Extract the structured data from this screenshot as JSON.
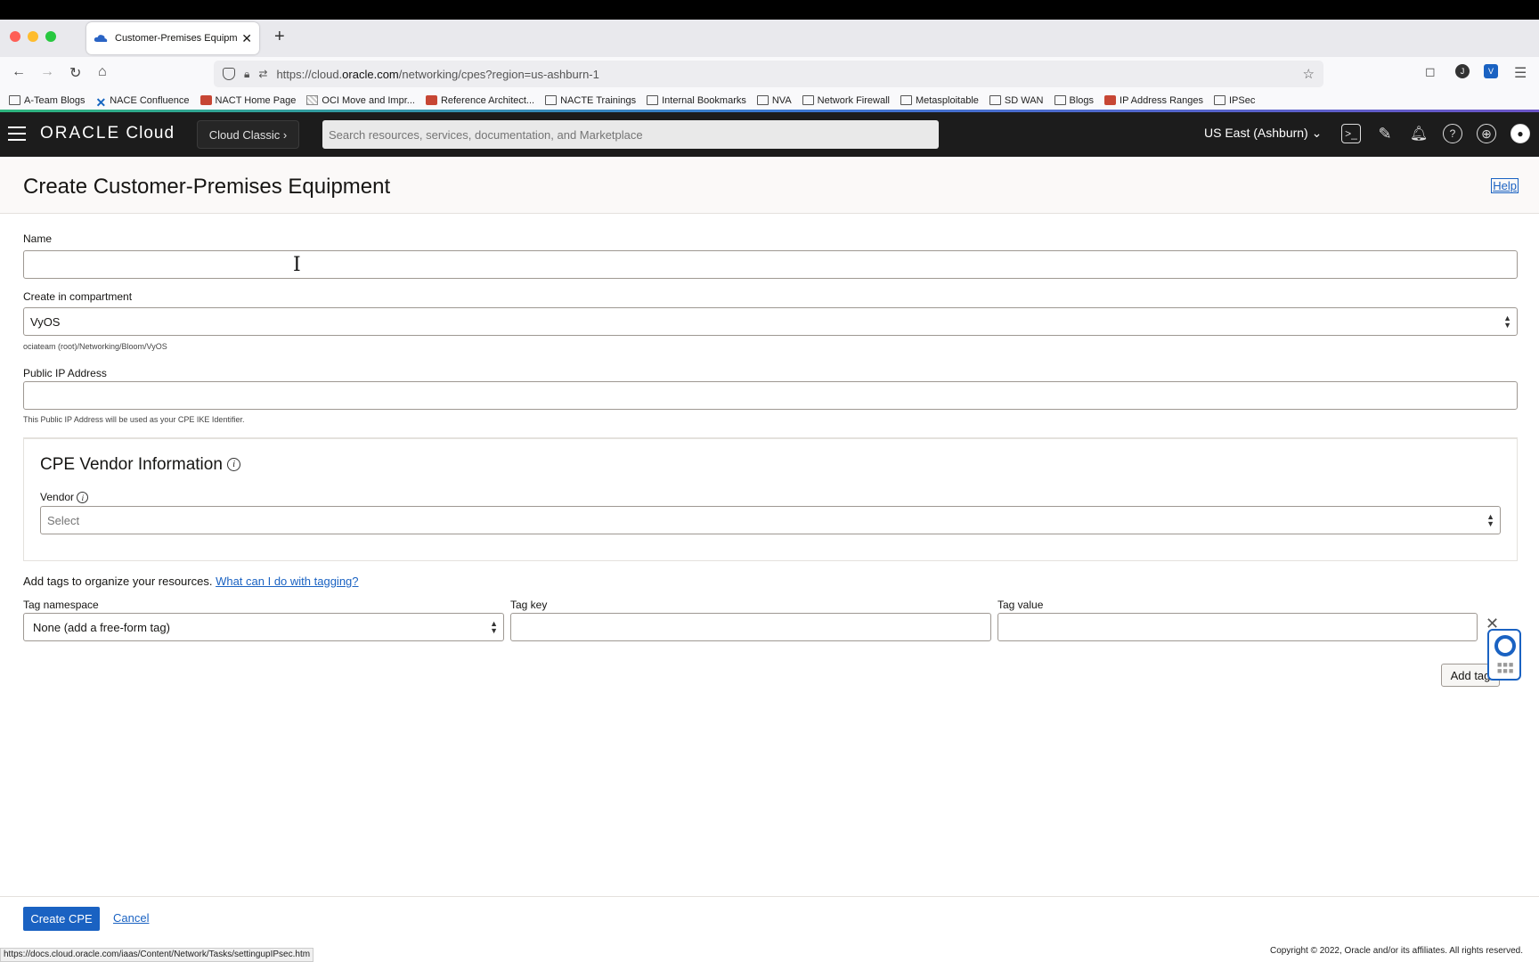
{
  "browser": {
    "tab_title": "Customer-Premises Equipment",
    "url_prefix": "https://cloud.",
    "url_domain": "oracle.com",
    "url_suffix": "/networking/cpes?region=us-ashburn-1",
    "bookmarks": [
      {
        "label": "A-Team Blogs",
        "icon": "folder"
      },
      {
        "label": "NACE Confluence",
        "icon": "confluence"
      },
      {
        "label": "NACT Home Page",
        "icon": "oracle"
      },
      {
        "label": "OCI Move and Impr...",
        "icon": "image"
      },
      {
        "label": "Reference Architect...",
        "icon": "oracle"
      },
      {
        "label": "NACTE Trainings",
        "icon": "folder"
      },
      {
        "label": "Internal Bookmarks",
        "icon": "folder"
      },
      {
        "label": "NVA",
        "icon": "folder"
      },
      {
        "label": "Network Firewall",
        "icon": "folder"
      },
      {
        "label": "Metasploitable",
        "icon": "folder"
      },
      {
        "label": "SD WAN",
        "icon": "folder"
      },
      {
        "label": "Blogs",
        "icon": "folder"
      },
      {
        "label": "IP Address Ranges",
        "icon": "oracle"
      },
      {
        "label": "IPSec",
        "icon": "folder"
      }
    ],
    "status_url": "https://docs.cloud.oracle.com/iaas/Content/Network/Tasks/settingupIPsec.htm"
  },
  "header": {
    "logo": "ORACLE",
    "logo_suffix": "Cloud",
    "classic_label": "Cloud Classic",
    "search_placeholder": "Search resources, services, documentation, and Marketplace",
    "region": "US East (Ashburn)"
  },
  "page": {
    "title": "Create Customer-Premises Equipment",
    "help_link": "Help"
  },
  "form": {
    "name_label": "Name",
    "name_value": "",
    "compartment_label": "Create in compartment",
    "compartment_value": "VyOS",
    "compartment_path": "ociateam (root)/Networking/Bloom/VyOS",
    "ip_label": "Public IP Address",
    "ip_value": "",
    "ip_help": "This Public IP Address will be used as your CPE IKE Identifier.",
    "vendor_section_title": "CPE Vendor Information",
    "vendor_label": "Vendor",
    "vendor_placeholder": "Select",
    "tags_text": "Add tags to organize your resources.",
    "tags_link": "What can I do with tagging?",
    "tag_namespace_label": "Tag namespace",
    "tag_namespace_value": "None (add a free-form tag)",
    "tag_key_label": "Tag key",
    "tag_value_label": "Tag value",
    "add_tag_button": "Add tag"
  },
  "footer": {
    "create_button": "Create CPE",
    "cancel_link": "Cancel",
    "copyright": "Copyright © 2022, Oracle and/or its affiliates. All rights reserved."
  },
  "colors": {
    "accent": "#1a62c2",
    "header_bg": "#1c1c1c"
  }
}
